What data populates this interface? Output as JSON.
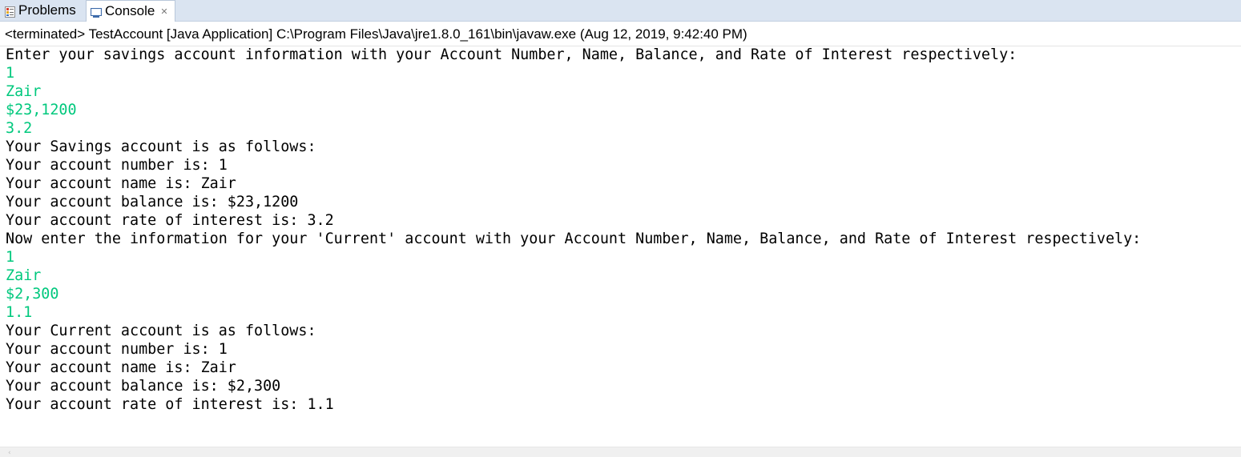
{
  "tabs": {
    "problems_label": "Problems",
    "console_label": "Console"
  },
  "status_line": "<terminated> TestAccount [Java Application] C:\\Program Files\\Java\\jre1.8.0_161\\bin\\javaw.exe (Aug 12, 2019, 9:42:40 PM)",
  "colors": {
    "stdin": "#00c87d",
    "stdout": "#000000",
    "tab_bar": "#dae4f1"
  },
  "console": {
    "lines": [
      {
        "kind": "out",
        "text": "Enter your savings account information with your Account Number, Name, Balance, and Rate of Interest respectively:"
      },
      {
        "kind": "in",
        "text": "1"
      },
      {
        "kind": "in",
        "text": "Zair"
      },
      {
        "kind": "in",
        "text": "$23,1200"
      },
      {
        "kind": "in",
        "text": "3.2"
      },
      {
        "kind": "out",
        "text": "Your Savings account is as follows:"
      },
      {
        "kind": "out",
        "text": "Your account number is: 1"
      },
      {
        "kind": "out",
        "text": "Your account name is: Zair"
      },
      {
        "kind": "out",
        "text": "Your account balance is: $23,1200"
      },
      {
        "kind": "out",
        "text": "Your account rate of interest is: 3.2"
      },
      {
        "kind": "out",
        "text": "Now enter the information for your 'Current' account with your Account Number, Name, Balance, and Rate of Interest respectively:"
      },
      {
        "kind": "in",
        "text": "1"
      },
      {
        "kind": "in",
        "text": "Zair"
      },
      {
        "kind": "in",
        "text": "$2,300"
      },
      {
        "kind": "in",
        "text": "1.1"
      },
      {
        "kind": "out",
        "text": "Your Current account is as follows:"
      },
      {
        "kind": "out",
        "text": "Your account number is: 1"
      },
      {
        "kind": "out",
        "text": "Your account name is: Zair"
      },
      {
        "kind": "out",
        "text": "Your account balance is: $2,300"
      },
      {
        "kind": "out",
        "text": "Your account rate of interest is: 1.1"
      }
    ]
  },
  "icons": {
    "problems": "problems-icon",
    "console": "console-icon",
    "close": "close-icon",
    "scroll_left": "scroll-left-icon"
  }
}
